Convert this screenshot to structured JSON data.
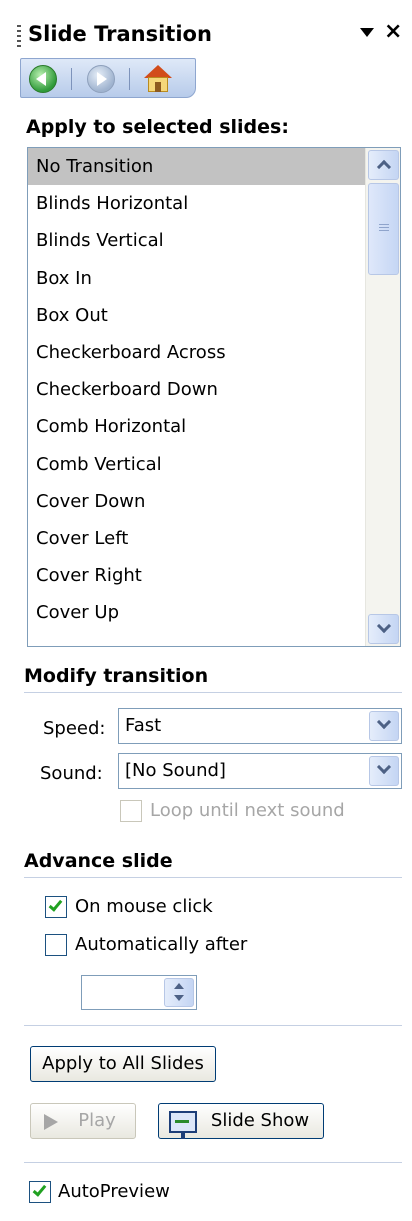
{
  "pane": {
    "title": "Slide Transition",
    "close_label": "×"
  },
  "nav": {
    "back_icon": "back-arrow-icon",
    "forward_icon": "forward-arrow-icon",
    "home_icon": "home-icon"
  },
  "apply_section": {
    "label": "Apply to selected slides:",
    "selected_index": 0,
    "items": [
      "No Transition",
      "Blinds Horizontal",
      "Blinds Vertical",
      "Box In",
      "Box Out",
      "Checkerboard Across",
      "Checkerboard Down",
      "Comb Horizontal",
      "Comb Vertical",
      "Cover Down",
      "Cover Left",
      "Cover Right",
      "Cover Up"
    ]
  },
  "modify": {
    "heading": "Modify transition",
    "speed_label": "Speed:",
    "speed_value": "Fast",
    "sound_label": "Sound:",
    "sound_value": "[No Sound]",
    "loop_label": "Loop until next sound",
    "loop_checked": false
  },
  "advance": {
    "heading": "Advance slide",
    "on_click_label": "On mouse click",
    "on_click_checked": true,
    "auto_label": "Automatically after",
    "auto_checked": false,
    "auto_value": ""
  },
  "actions": {
    "apply_all": "Apply to All Slides",
    "play": "Play",
    "slide_show": "Slide Show"
  },
  "autopreview": {
    "label": "AutoPreview",
    "checked": true
  },
  "colors": {
    "selection": "#c2c2c2",
    "border": "#7f9db9",
    "check_green": "#21a121"
  }
}
